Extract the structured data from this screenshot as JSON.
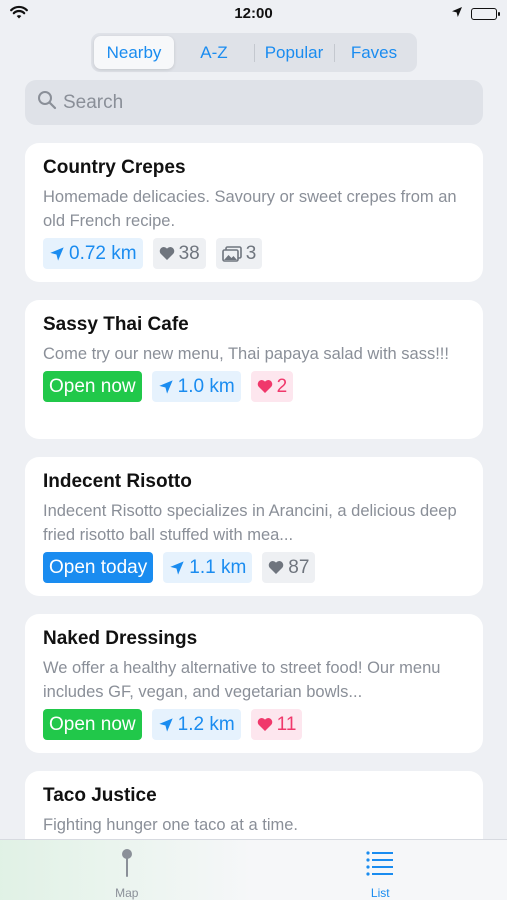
{
  "status_bar": {
    "time": "12:00"
  },
  "segments": [
    "Nearby",
    "A-Z",
    "Popular",
    "Faves"
  ],
  "search": {
    "placeholder": "Search"
  },
  "cards": [
    {
      "title": "Country Crepes",
      "description": "Homemade delicacies. Savoury or sweet crepes from an old French recipe.",
      "distance": "0.72 km",
      "likes": "38",
      "photos": "3"
    },
    {
      "title": "Sassy Thai Cafe",
      "description": "Come try our new menu, Thai papaya salad with sass!!!",
      "status": "Open now",
      "distance": "1.0 km",
      "hearts": "2"
    },
    {
      "title": "Indecent Risotto",
      "description": "Indecent Risotto specializes in Arancini, a delicious deep fried risotto ball stuffed with mea...",
      "status": "Open today",
      "distance": "1.1 km",
      "likes": "87"
    },
    {
      "title": "Naked Dressings",
      "description": "We offer a healthy alternative to street food! Our menu includes GF, vegan, and vegetarian bowls...",
      "status": "Open now",
      "distance": "1.2 km",
      "hearts": "11"
    },
    {
      "title": "Taco Justice",
      "description": "Fighting hunger one taco at a time."
    }
  ],
  "tabs": {
    "map": "Map",
    "list": "List"
  },
  "colors": {
    "accent": "#1a8cf0",
    "open": "#21c84a",
    "heart": "#f0386b"
  }
}
